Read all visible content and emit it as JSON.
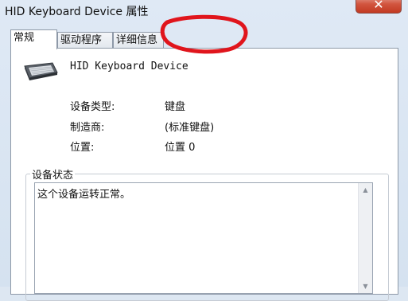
{
  "window": {
    "title": "HID Keyboard Device 属性",
    "close_label": "✕"
  },
  "tabs": [
    {
      "label": "常规",
      "active": true
    },
    {
      "label": "驱动程序",
      "active": false
    },
    {
      "label": "详细信息",
      "active": false
    }
  ],
  "device": {
    "icon": "keyboard-icon",
    "name": "HID Keyboard Device"
  },
  "properties": [
    {
      "label": "设备类型:",
      "value": "键盘"
    },
    {
      "label": "制造商:",
      "value": "(标准键盘)"
    },
    {
      "label": "位置:",
      "value": "位置 0"
    }
  ],
  "status": {
    "group_label": "设备状态",
    "text": "这个设备运转正常。"
  },
  "annotation": {
    "color": "#e0151c"
  }
}
